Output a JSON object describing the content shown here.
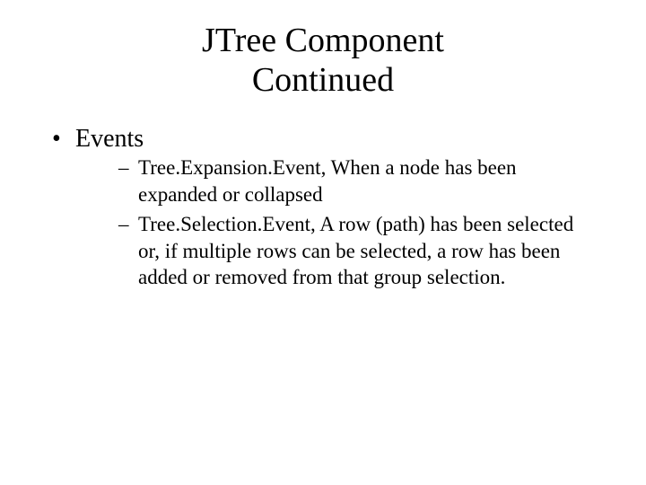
{
  "title_line1": "JTree Component",
  "title_line2": "Continued",
  "bullet_main": "Events",
  "sub_bullets": {
    "0": "Tree.Expansion.Event, When a node has been expanded or collapsed",
    "1": "Tree.Selection.Event, A row (path) has been selected or, if multiple rows can be selected, a row has been added or removed from that group selection."
  }
}
